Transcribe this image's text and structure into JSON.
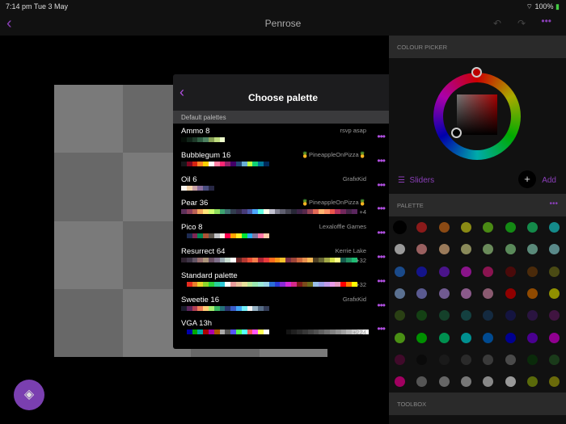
{
  "status": {
    "time": "7:14 pm  Tue 3 May",
    "battery": "100%"
  },
  "nav": {
    "title": "Penrose"
  },
  "modal": {
    "title": "Choose palette",
    "section": "Default palettes",
    "palettes": [
      {
        "name": "Ammo 8",
        "author": "rsvp asap",
        "more": "",
        "colors": [
          "#040c06",
          "#112318",
          "#1e3a29",
          "#305d42",
          "#4d8061",
          "#89a257",
          "#bedc7f",
          "#eeffcc"
        ]
      },
      {
        "name": "Bubblegum 16",
        "author": "🍍PineappleOnPizza🍍",
        "more": "",
        "colors": [
          "#16171a",
          "#7f0622",
          "#d62411",
          "#ff8426",
          "#ffd100",
          "#fafdff",
          "#ff80a4",
          "#ff2674",
          "#94216a",
          "#430067",
          "#234975",
          "#68aed4",
          "#bfff3c",
          "#10d275",
          "#007899",
          "#002859"
        ]
      },
      {
        "name": "Oil 6",
        "author": "GrafxKid",
        "more": "",
        "colors": [
          "#fbf5ef",
          "#f2d3ab",
          "#c69fa5",
          "#8b6d9c",
          "#494d7e",
          "#272744"
        ]
      },
      {
        "name": "Pear 36",
        "author": "🍍PineappleOnPizza🍍",
        "more": "+4",
        "colors": [
          "#5e315b",
          "#8c3f5d",
          "#ba6156",
          "#f2a65e",
          "#ffe478",
          "#cfff70",
          "#8fde5d",
          "#3ca370",
          "#3d6e70",
          "#323e4f",
          "#322947",
          "#473b78",
          "#4b5bab",
          "#4da6ff",
          "#66ffe3",
          "#ffffeb",
          "#c2c2d1",
          "#7e7e8f",
          "#606070",
          "#43434f",
          "#272736",
          "#3e2347",
          "#57294b",
          "#964253",
          "#e36956",
          "#ffb570",
          "#ff9166",
          "#eb564b",
          "#b0305c",
          "#73275c",
          "#422445",
          "#5a265e"
        ]
      },
      {
        "name": "Pico 8",
        "author": "Lexaloffle Games",
        "more": "",
        "colors": [
          "#000000",
          "#1d2b53",
          "#7e2553",
          "#008751",
          "#ab5236",
          "#5f574f",
          "#c2c3c7",
          "#fff1e8",
          "#ff004d",
          "#ffa300",
          "#ffec27",
          "#00e436",
          "#29adff",
          "#83769c",
          "#ff77a8",
          "#ffccaa"
        ]
      },
      {
        "name": "Resurrect 64",
        "author": "Kerrie Lake",
        "more": "+32",
        "colors": [
          "#2e222f",
          "#3e3546",
          "#625565",
          "#966c6c",
          "#ab947a",
          "#694f62",
          "#7f708a",
          "#9babb2",
          "#c7dcd0",
          "#ffffff",
          "#6e2727",
          "#b33831",
          "#ea4f36",
          "#f57d4a",
          "#ae2334",
          "#e83b3b",
          "#fb6b1d",
          "#f79617",
          "#f9c22b",
          "#7a3045",
          "#9e4539",
          "#cd683d",
          "#e6904e",
          "#fbb954",
          "#4c3e24",
          "#676633",
          "#a2a947",
          "#d5e04b",
          "#fbff86",
          "#165a4c",
          "#239063",
          "#1ebc73"
        ]
      },
      {
        "name": "Standard palette",
        "author": "",
        "more": "+32",
        "colors": [
          "#000000",
          "#e62b1f",
          "#eb7f2a",
          "#e8d12a",
          "#8fd62a",
          "#2ad13a",
          "#2ad19a",
          "#2ac8d6",
          "#ffffff",
          "#e89a9a",
          "#e8c09a",
          "#e8e09a",
          "#b8e89a",
          "#9ae8b0",
          "#9ae8d8",
          "#9ad6e8",
          "#2a6ed6",
          "#2a3ad6",
          "#8a2ad6",
          "#d62ad6",
          "#d62a8a",
          "#7a1a1a",
          "#7a4a1a",
          "#6a6a1a",
          "#9ac0e8",
          "#9aa0e8",
          "#c09ae8",
          "#e89ae8",
          "#e89ac0",
          "#ff0000",
          "#ff7a00",
          "#ffff00"
        ]
      },
      {
        "name": "Sweetie 16",
        "author": "GrafxKid",
        "more": "",
        "colors": [
          "#1a1c2c",
          "#5d275d",
          "#b13e53",
          "#ef7d57",
          "#ffcd75",
          "#a7f070",
          "#38b764",
          "#257179",
          "#29366f",
          "#3b5dc9",
          "#41a6f6",
          "#73eff7",
          "#f4f4f4",
          "#94b0c2",
          "#566c86",
          "#333c57"
        ]
      },
      {
        "name": "VGA 13h",
        "author": "",
        "more": "+224",
        "colors": [
          "#000000",
          "#0000aa",
          "#00aa00",
          "#00aaaa",
          "#aa0000",
          "#aa00aa",
          "#aa5500",
          "#aaaaaa",
          "#555555",
          "#5555ff",
          "#55ff55",
          "#55ffff",
          "#ff5555",
          "#ff55ff",
          "#ffff55",
          "#ffffff",
          "#000000",
          "#141414",
          "#202020",
          "#2c2c2c",
          "#383838",
          "#454545",
          "#515151",
          "#616161",
          "#717171",
          "#828282",
          "#929292",
          "#a2a2a2",
          "#b6b6b6",
          "#cbcbcb",
          "#e3e3e3",
          "#ffffff"
        ]
      }
    ]
  },
  "right": {
    "colour_picker": "COLOUR PICKER",
    "sliders": "Sliders",
    "add": "Add",
    "palette": "PALETTE",
    "toolbox": "TOOLBOX",
    "grid": [
      "#000000",
      "#8b1a1a",
      "#8b4a14",
      "#8a8a14",
      "#4a8a14",
      "#148a14",
      "#148a4a",
      "#148a8a",
      "#9a9a9a",
      "#9a6060",
      "#9a7a5a",
      "#8a8a5a",
      "#6a8a5a",
      "#5a8a5a",
      "#5a8a7a",
      "#5a8a8a",
      "#1a4a8a",
      "#14148a",
      "#4a148a",
      "#8a148a",
      "#8a1450",
      "#4a0a0a",
      "#4a2a0a",
      "#4a4a14",
      "#5a7090",
      "#5a5a90",
      "#705a90",
      "#8a5a8a",
      "#8a5a70",
      "#900000",
      "#904a00",
      "#909000",
      "#2a4014",
      "#144014",
      "#14402a",
      "#144040",
      "#142a40",
      "#141440",
      "#2a1440",
      "#401440",
      "#4a9014",
      "#009000",
      "#009050",
      "#009090",
      "#004a90",
      "#000090",
      "#4a0090",
      "#900090",
      "#400a2a",
      "#0a0a0a",
      "#1a1a1a",
      "#2a2a2a",
      "#3a3a3a",
      "#4a4a4a",
      "#0a2a0a",
      "#1a3a1a",
      "#a00060",
      "#555555",
      "#666666",
      "#777777",
      "#888888",
      "#999999",
      "#5a6a0a",
      "#6a6a0a"
    ]
  }
}
